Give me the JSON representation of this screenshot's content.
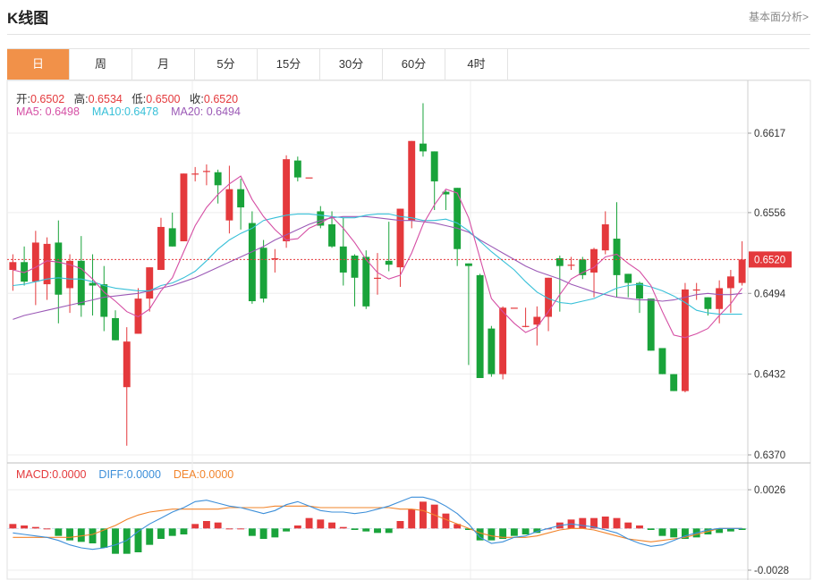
{
  "header": {
    "title": "K线图",
    "link": "基本面分析>"
  },
  "tabs": [
    {
      "label": "日",
      "active": true
    },
    {
      "label": "周",
      "active": false
    },
    {
      "label": "月",
      "active": false
    },
    {
      "label": "5分",
      "active": false
    },
    {
      "label": "15分",
      "active": false
    },
    {
      "label": "30分",
      "active": false
    },
    {
      "label": "60分",
      "active": false
    },
    {
      "label": "4时",
      "active": false
    }
  ],
  "ohlc": {
    "open_label": "开:",
    "open": "0.6502",
    "high_label": "高:",
    "high": "0.6534",
    "low_label": "低:",
    "low": "0.6500",
    "close_label": "收:",
    "close": "0.6520"
  },
  "ma": {
    "ma5_label": "MA5:",
    "ma5": "0.6498",
    "ma10_label": "MA10:",
    "ma10": "0.6478",
    "ma20_label": "MA20:",
    "ma20": "0.6494"
  },
  "macd_info": {
    "macd_label": "MACD:",
    "macd": "0.0000",
    "diff_label": "DIFF:",
    "diff": "0.0000",
    "dea_label": "DEA:",
    "dea": "0.0000"
  },
  "colors": {
    "up": "#e4393c",
    "down": "#19a33a",
    "ma5": "#d54ea4",
    "ma10": "#38c0d8",
    "ma20": "#9b59b6",
    "diff": "#3d8fd9",
    "dea": "#f2842b",
    "tab_active": "#f19149"
  },
  "chart_data": [
    {
      "type": "candlestick",
      "y_ticks": [
        "0.6617",
        "0.6556",
        "0.6494",
        "0.6432",
        "0.6370"
      ],
      "ylim": [
        0.637,
        0.6617
      ],
      "last_price": "0.6520",
      "candles": [
        [
          0.6512,
          0.6524,
          0.6496,
          0.6518
        ],
        [
          0.6518,
          0.653,
          0.65,
          0.6503
        ],
        [
          0.6503,
          0.6542,
          0.6485,
          0.6533
        ],
        [
          0.6501,
          0.6537,
          0.6489,
          0.6532
        ],
        [
          0.6533,
          0.655,
          0.6471,
          0.6493
        ],
        [
          0.6498,
          0.6524,
          0.6479,
          0.6519
        ],
        [
          0.6519,
          0.6538,
          0.6476,
          0.6485
        ],
        [
          0.6502,
          0.6524,
          0.6477,
          0.65
        ],
        [
          0.6501,
          0.6515,
          0.6465,
          0.6476
        ],
        [
          0.6475,
          0.6481,
          0.6458,
          0.6458
        ],
        [
          0.6422,
          0.6468,
          0.6377,
          0.6457
        ],
        [
          0.6463,
          0.6498,
          0.6463,
          0.649
        ],
        [
          0.649,
          0.6512,
          0.648,
          0.6514
        ],
        [
          0.6512,
          0.6552,
          0.6512,
          0.6545
        ],
        [
          0.6544,
          0.6556,
          0.6545,
          0.653
        ],
        [
          0.6534,
          0.6586,
          0.6534,
          0.6586
        ],
        [
          0.6586,
          0.6591,
          0.658,
          0.6586
        ],
        [
          0.6588,
          0.6593,
          0.6577,
          0.6588
        ],
        [
          0.6587,
          0.6589,
          0.6563,
          0.6577
        ],
        [
          0.655,
          0.6592,
          0.654,
          0.6574
        ],
        [
          0.6574,
          0.6582,
          0.6543,
          0.656
        ],
        [
          0.6548,
          0.6557,
          0.6486,
          0.6488
        ],
        [
          0.6529,
          0.6535,
          0.6487,
          0.649
        ],
        [
          0.652,
          0.6528,
          0.651,
          0.6521
        ],
        [
          0.6534,
          0.66,
          0.6529,
          0.6597
        ],
        [
          0.6596,
          0.6599,
          0.658,
          0.6583
        ],
        [
          0.6583,
          0.6583,
          0.6583,
          0.6583
        ],
        [
          0.6557,
          0.6561,
          0.6544,
          0.6546
        ],
        [
          0.6547,
          0.6557,
          0.6529,
          0.653
        ],
        [
          0.653,
          0.6552,
          0.65,
          0.651
        ],
        [
          0.6523,
          0.6524,
          0.6484,
          0.6506
        ],
        [
          0.6522,
          0.6527,
          0.6482,
          0.6484
        ],
        [
          0.6506,
          0.6525,
          0.6493,
          0.6506
        ],
        [
          0.6519,
          0.6549,
          0.6511,
          0.6516
        ],
        [
          0.6514,
          0.6559,
          0.6499,
          0.6559
        ],
        [
          0.655,
          0.6609,
          0.6544,
          0.6611
        ],
        [
          0.6609,
          0.664,
          0.6599,
          0.6603
        ],
        [
          0.6603,
          0.6601,
          0.6558,
          0.658
        ],
        [
          0.6572,
          0.6573,
          0.6558,
          0.657
        ],
        [
          0.6575,
          0.6554,
          0.6515,
          0.6528
        ],
        [
          0.6517,
          0.6512,
          0.6439,
          0.6515
        ],
        [
          0.6508,
          0.6509,
          0.6433,
          0.6429
        ],
        [
          0.6467,
          0.6469,
          0.643,
          0.6432
        ],
        [
          0.6432,
          0.6484,
          0.6428,
          0.6483
        ],
        [
          0.6483,
          0.6483,
          0.6483,
          0.6483
        ],
        [
          0.6469,
          0.6483,
          0.6468,
          0.6469
        ],
        [
          0.647,
          0.6484,
          0.6454,
          0.6476
        ],
        [
          0.6476,
          0.6505,
          0.6465,
          0.6506
        ],
        [
          0.6521,
          0.6523,
          0.648,
          0.6515
        ],
        [
          0.6516,
          0.6522,
          0.6512,
          0.6516
        ],
        [
          0.652,
          0.6522,
          0.6505,
          0.6508
        ],
        [
          0.651,
          0.6529,
          0.6491,
          0.6528
        ],
        [
          0.6527,
          0.6557,
          0.6524,
          0.6547
        ],
        [
          0.6536,
          0.6564,
          0.6491,
          0.6508
        ],
        [
          0.6509,
          0.6502,
          0.6491,
          0.6502
        ],
        [
          0.6502,
          0.6503,
          0.6479,
          0.649
        ],
        [
          0.649,
          0.6483,
          0.6454,
          0.645
        ],
        [
          0.6452,
          0.6452,
          0.6435,
          0.6432
        ],
        [
          0.6432,
          0.6432,
          0.6419,
          0.6419
        ],
        [
          0.6419,
          0.6502,
          0.6418,
          0.6497
        ],
        [
          0.6497,
          0.6502,
          0.6489,
          0.6497
        ],
        [
          0.6491,
          0.649,
          0.6477,
          0.6482
        ],
        [
          0.6482,
          0.6504,
          0.6471,
          0.6498
        ],
        [
          0.6498,
          0.6512,
          0.6479,
          0.6507
        ],
        [
          0.6502,
          0.6534,
          0.65,
          0.652
        ]
      ],
      "ma5": [
        0.6512,
        0.651,
        0.6514,
        0.6519,
        0.6518,
        0.6516,
        0.6513,
        0.6505,
        0.6495,
        0.6488,
        0.648,
        0.6476,
        0.6482,
        0.6496,
        0.6506,
        0.6526,
        0.6546,
        0.656,
        0.657,
        0.6578,
        0.6584,
        0.6566,
        0.6553,
        0.6543,
        0.6535,
        0.6536,
        0.6544,
        0.6548,
        0.6553,
        0.6544,
        0.6533,
        0.652,
        0.651,
        0.6505,
        0.6508,
        0.6525,
        0.6547,
        0.6562,
        0.6574,
        0.6571,
        0.6552,
        0.6521,
        0.649,
        0.648,
        0.6471,
        0.6464,
        0.6468,
        0.648,
        0.6493,
        0.6505,
        0.651,
        0.6514,
        0.6522,
        0.6524,
        0.6517,
        0.6511,
        0.65,
        0.648,
        0.6462,
        0.646,
        0.6463,
        0.6467,
        0.6477,
        0.6486,
        0.6498
      ],
      "ma10": [
        0.65,
        0.6501,
        0.6503,
        0.6505,
        0.6506,
        0.6505,
        0.6505,
        0.6503,
        0.65,
        0.6498,
        0.6497,
        0.6496,
        0.6496,
        0.65,
        0.6502,
        0.6506,
        0.6511,
        0.6519,
        0.6528,
        0.6535,
        0.654,
        0.6544,
        0.655,
        0.6552,
        0.6554,
        0.6555,
        0.6555,
        0.6554,
        0.6553,
        0.6552,
        0.6552,
        0.6554,
        0.6555,
        0.6555,
        0.6553,
        0.6552,
        0.655,
        0.655,
        0.6551,
        0.6548,
        0.6542,
        0.6534,
        0.6526,
        0.6519,
        0.6512,
        0.6503,
        0.6495,
        0.649,
        0.6487,
        0.6486,
        0.6488,
        0.649,
        0.6494,
        0.6498,
        0.65,
        0.6501,
        0.6499,
        0.6496,
        0.6492,
        0.6487,
        0.6481,
        0.6479,
        0.6478,
        0.6478,
        0.6478
      ],
      "ma20": [
        0.6474,
        0.6477,
        0.6479,
        0.6481,
        0.6483,
        0.6485,
        0.6487,
        0.6489,
        0.6491,
        0.6492,
        0.6493,
        0.6494,
        0.6496,
        0.6498,
        0.65,
        0.6503,
        0.6506,
        0.651,
        0.6514,
        0.6518,
        0.6522,
        0.6526,
        0.653,
        0.6535,
        0.6539,
        0.6543,
        0.6547,
        0.655,
        0.6552,
        0.6553,
        0.6553,
        0.6553,
        0.6552,
        0.6551,
        0.655,
        0.655,
        0.6549,
        0.6548,
        0.6546,
        0.6544,
        0.6541,
        0.6535,
        0.653,
        0.6525,
        0.652,
        0.6515,
        0.6511,
        0.6508,
        0.6505,
        0.6501,
        0.6498,
        0.6495,
        0.6493,
        0.6491,
        0.649,
        0.6489,
        0.6489,
        0.6488,
        0.6489,
        0.6491,
        0.6493,
        0.6494,
        0.6493,
        0.6493,
        0.6494
      ]
    },
    {
      "type": "bar",
      "y_ticks": [
        "0.0026",
        "-0.0028"
      ],
      "ylim": [
        -0.0028,
        0.0026
      ],
      "macd": [
        0.0003,
        0.0002,
        0.0001,
        0.0,
        -0.0005,
        -0.0008,
        -0.0009,
        -0.001,
        -0.0013,
        -0.0017,
        -0.0017,
        -0.0016,
        -0.0011,
        -0.0007,
        -0.0005,
        -0.0004,
        0.0003,
        0.0005,
        0.0004,
        0.0,
        0.0,
        -0.0005,
        -0.0007,
        -0.0006,
        -0.0002,
        0.0002,
        0.0007,
        0.0006,
        0.0004,
        0.0001,
        -0.0001,
        -0.0002,
        -0.0003,
        -0.0003,
        0.0005,
        0.0013,
        0.0018,
        0.0016,
        0.001,
        0.0003,
        -0.0001,
        -0.0008,
        -0.0008,
        -0.0007,
        -0.0005,
        -0.0004,
        -0.0003,
        0.0,
        0.0004,
        0.0006,
        0.0007,
        0.0007,
        0.0008,
        0.0007,
        0.0004,
        0.0002,
        -0.0001,
        -0.0005,
        -0.0006,
        -0.0007,
        -0.0006,
        -0.0004,
        -0.0003,
        -0.0002,
        -0.0001
      ],
      "diff": [
        -0.0003,
        -0.0004,
        -0.0005,
        -0.0006,
        -0.0008,
        -0.0011,
        -0.0013,
        -0.0014,
        -0.0013,
        -0.0011,
        -0.0008,
        -0.0002,
        0.0003,
        0.0007,
        0.0011,
        0.0014,
        0.0018,
        0.0019,
        0.0017,
        0.0015,
        0.0014,
        0.0012,
        0.001,
        0.0012,
        0.0016,
        0.0018,
        0.0015,
        0.0012,
        0.0011,
        0.0011,
        0.001,
        0.0011,
        0.0013,
        0.0015,
        0.0018,
        0.0021,
        0.0021,
        0.0019,
        0.0015,
        0.001,
        0.0003,
        -0.0006,
        -0.001,
        -0.0009,
        -0.0006,
        -0.0005,
        -0.0002,
        0.0,
        0.0002,
        0.0003,
        0.0002,
        0.0001,
        -0.0001,
        -0.0003,
        -0.0007,
        -0.001,
        -0.0012,
        -0.0011,
        -0.0008,
        -0.0005,
        -0.0003,
        -0.0001,
        0.0,
        0.0,
        0.0
      ],
      "dea": [
        -0.0006,
        -0.0006,
        -0.0006,
        -0.0006,
        -0.0006,
        -0.0006,
        -0.0005,
        -0.0004,
        -0.0001,
        0.0002,
        0.0006,
        0.0009,
        0.0011,
        0.0012,
        0.0013,
        0.0013,
        0.0013,
        0.0013,
        0.0013,
        0.0014,
        0.0014,
        0.0014,
        0.0014,
        0.0015,
        0.0015,
        0.0015,
        0.0015,
        0.0014,
        0.0014,
        0.0014,
        0.0014,
        0.0014,
        0.0014,
        0.0014,
        0.0013,
        0.0013,
        0.0012,
        0.0009,
        0.0006,
        0.0003,
        0.0,
        -0.0003,
        -0.0005,
        -0.0006,
        -0.0006,
        -0.0006,
        -0.0005,
        -0.0003,
        -0.0001,
        0.0,
        0.0,
        -0.0001,
        -0.0003,
        -0.0005,
        -0.0007,
        -0.0008,
        -0.0009,
        -0.0008,
        -0.0007,
        -0.0006,
        -0.0004,
        -0.0002,
        0.0,
        0.0,
        0.0
      ]
    }
  ]
}
